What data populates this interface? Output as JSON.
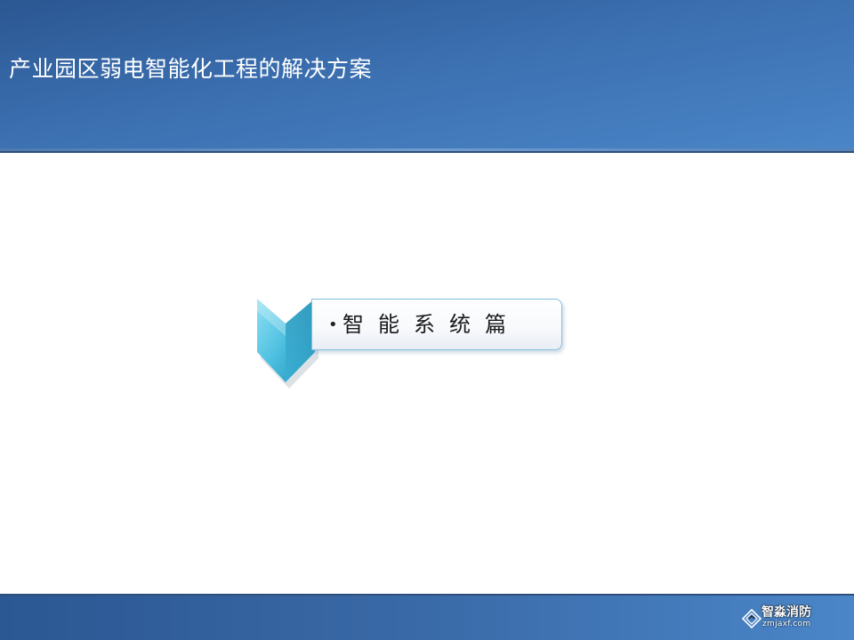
{
  "slide": {
    "title": "产业园区弱电智能化工程的解决方案",
    "section": {
      "bullet": "•",
      "label": "智能系统篇"
    }
  },
  "watermark": {
    "name": "智淼消防",
    "url": "zmjaxf.com",
    "logo_icon": "diamond-logo-icon"
  },
  "colors": {
    "header_top": "#2b5792",
    "header_bottom": "#4a86c8",
    "chevron_light": "#6fd0ea",
    "chevron_dark": "#1f8fb5",
    "box_border": "#7fc2da",
    "title_text": "#ffffff",
    "label_text": "#1a1a1a"
  }
}
